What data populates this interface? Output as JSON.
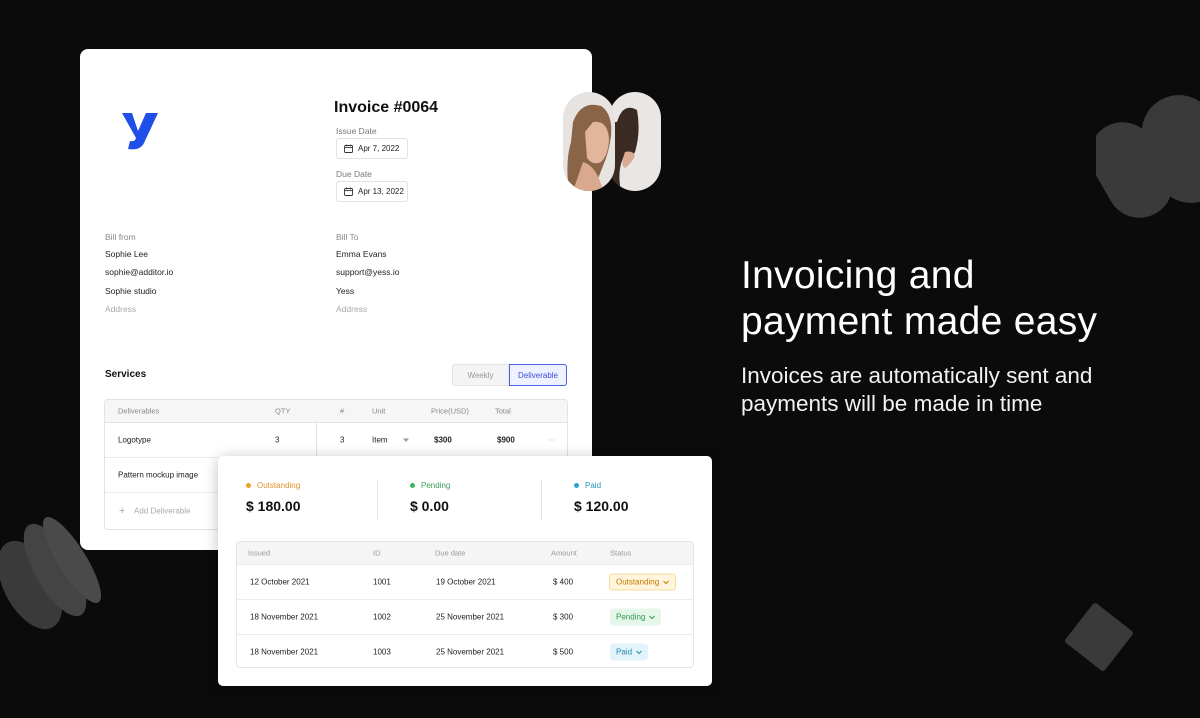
{
  "colors": {
    "background": "#0b0b0b",
    "brand_blue": "#1f4ee8",
    "outstanding": "#f0a020",
    "pending": "#3cb55b",
    "paid": "#2aa4cf"
  },
  "invoice": {
    "title": "Invoice #0064",
    "issue_date_label": "Issue Date",
    "issue_date": "Apr 7, 2022",
    "due_date_label": "Due Date",
    "due_date": "Apr 13, 2022",
    "bill_from": {
      "label": "Bill from",
      "name": "Sophie Lee",
      "email": "sophie@additor.io",
      "company": "Sophie studio",
      "address_placeholder": "Address"
    },
    "bill_to": {
      "label": "Bill To",
      "name": "Emma Evans",
      "email": "support@yess.io",
      "company": "Yess",
      "address_placeholder": "Address"
    },
    "services": {
      "title": "Services",
      "toggle": [
        "Weekly",
        "Deliverable"
      ],
      "columns": [
        "Deliverables",
        "QTY",
        "#",
        "Unit",
        "Price(USD)",
        "Total"
      ],
      "rows": [
        {
          "name": "Logotype",
          "qty": "3",
          "num": "3",
          "unit": "Item",
          "price": "$300",
          "total": "$900",
          "more": "···"
        },
        {
          "name": "Pattern mockup image"
        }
      ],
      "add_label": "Add Deliverable"
    }
  },
  "headline": {
    "line1": "Invoicing and",
    "line2": "payment made easy",
    "sub1": "Invoices are automatically sent and",
    "sub2": "payments will be made in time"
  },
  "payments": {
    "stats": [
      {
        "label": "Outstanding",
        "value": "$ 180.00"
      },
      {
        "label": "Pending",
        "value": "$ 0.00"
      },
      {
        "label": "Paid",
        "value": "$ 120.00"
      }
    ],
    "columns": [
      "Issued",
      "ID",
      "Due date",
      "Amount",
      "Status"
    ],
    "rows": [
      {
        "issued": "12 October 2021",
        "id": "1001",
        "due": "19 October 2021",
        "amount": "$ 400",
        "status": "Outstanding"
      },
      {
        "issued": "18 November 2021",
        "id": "1002",
        "due": "25 November 2021",
        "amount": "$ 300",
        "status": "Pending"
      },
      {
        "issued": "18 November 2021",
        "id": "1003",
        "due": "25 November 2021",
        "amount": "$ 500",
        "status": "Paid"
      }
    ]
  }
}
